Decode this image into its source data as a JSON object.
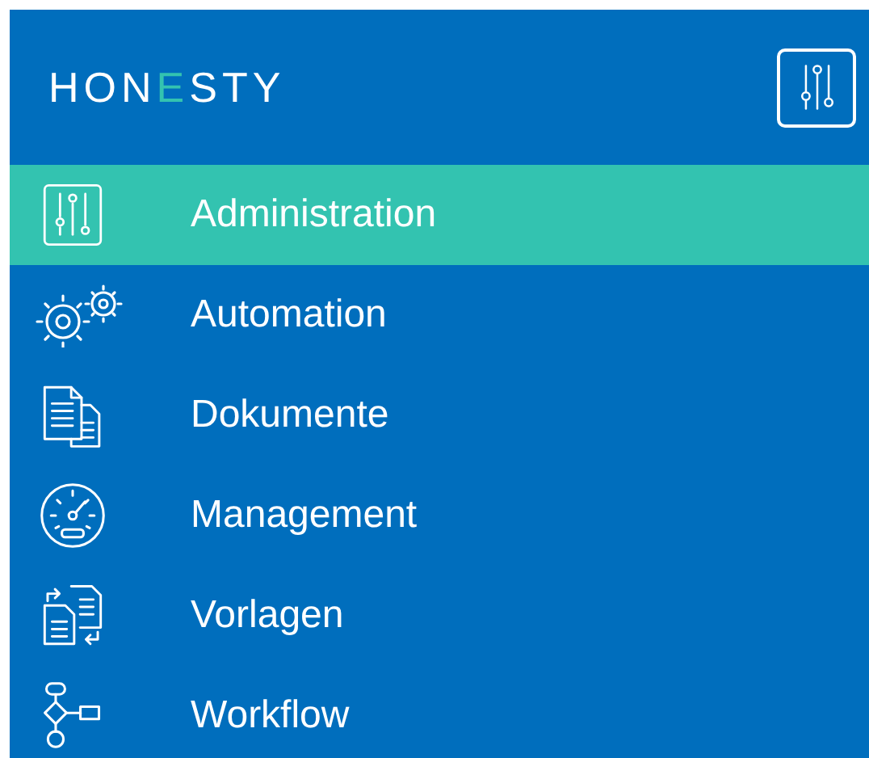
{
  "header": {
    "logo": [
      {
        "text": "HON",
        "accent": false
      },
      {
        "text": "E",
        "accent": true
      },
      {
        "text": "STY",
        "accent": false
      }
    ]
  },
  "menu": [
    {
      "label": "Administration",
      "selected": true
    },
    {
      "label": "Automation",
      "selected": false
    },
    {
      "label": "Dokumente",
      "selected": false
    },
    {
      "label": "Management",
      "selected": false
    },
    {
      "label": "Vorlagen",
      "selected": false
    },
    {
      "label": "Workflow",
      "selected": false
    }
  ]
}
